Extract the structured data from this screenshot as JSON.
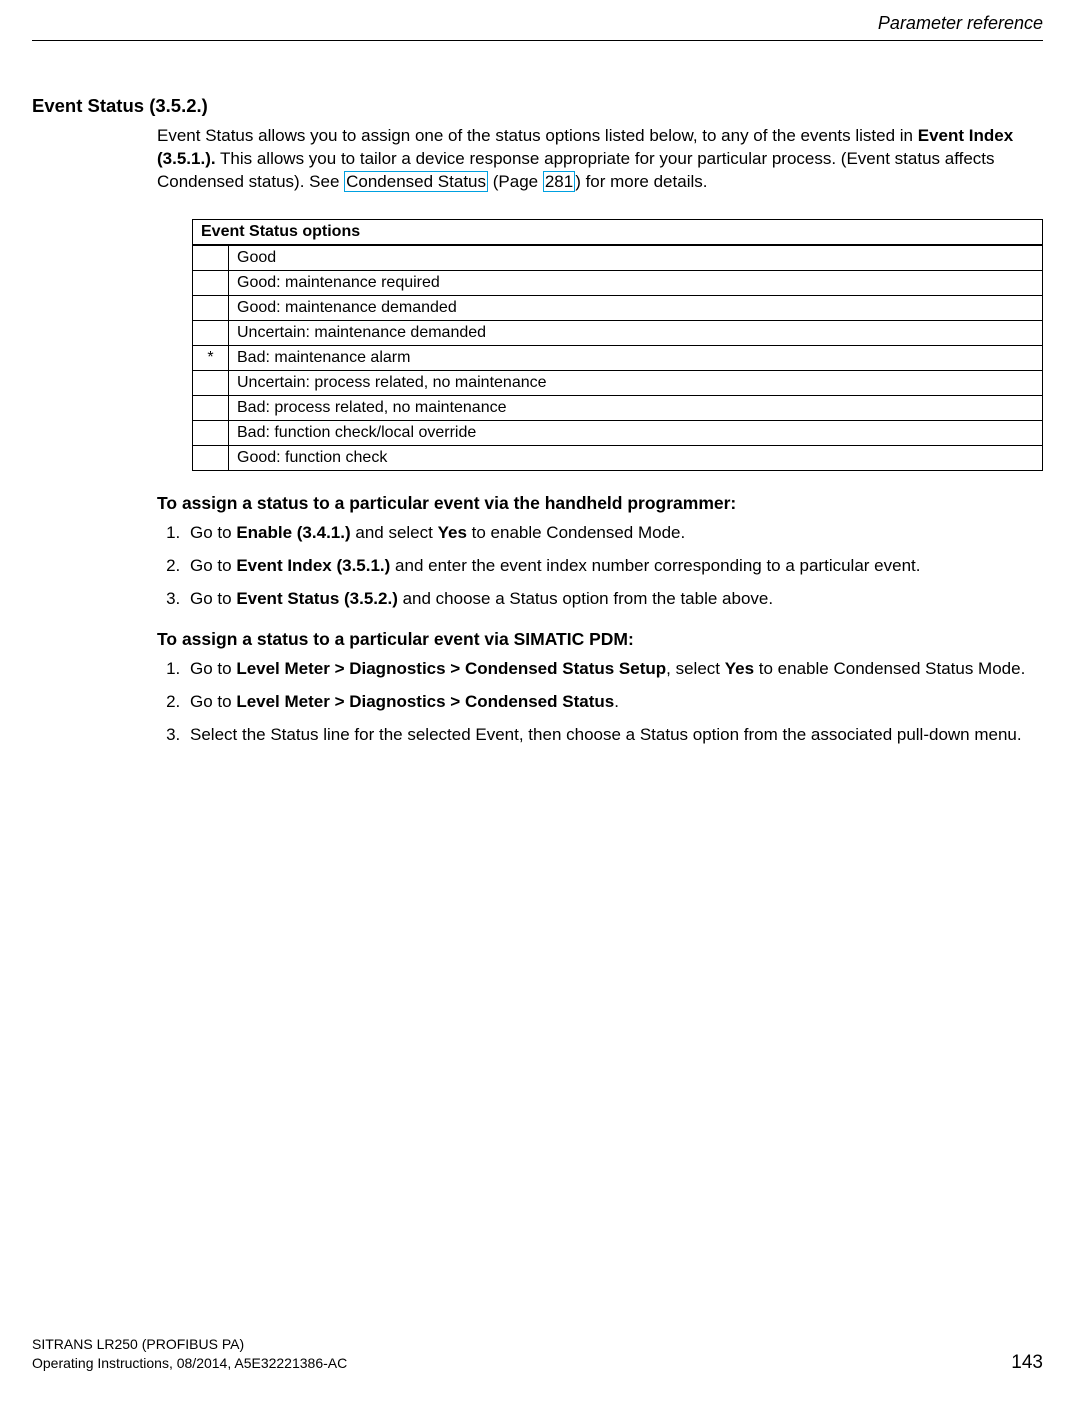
{
  "header": {
    "title": "Parameter reference"
  },
  "section": {
    "heading": "Event Status (3.5.2.)",
    "intro_pre": "Event Status allows you to assign one of the status options listed below, to any of the events listed in ",
    "intro_bold": "Event Index (3.5.1.).",
    "intro_mid": " This allows you to tailor a device response appropriate for your particular process. (Event status affects Condensed status). See ",
    "link_condensed": "Condensed Status",
    "intro_pg_pre": " (Page ",
    "link_page": "281",
    "intro_post": ") for more details."
  },
  "table": {
    "header": "Event Status options",
    "rows": [
      {
        "mark": "",
        "label": "Good"
      },
      {
        "mark": "",
        "label": "Good: maintenance required"
      },
      {
        "mark": "",
        "label": "Good: maintenance demanded"
      },
      {
        "mark": "",
        "label": "Uncertain: maintenance demanded"
      },
      {
        "mark": "*",
        "label": "Bad: maintenance alarm"
      },
      {
        "mark": "",
        "label": "Uncertain: process related, no maintenance"
      },
      {
        "mark": "",
        "label": "Bad: process related, no maintenance"
      },
      {
        "mark": "",
        "label": "Bad: function check/local override"
      },
      {
        "mark": "",
        "label": "Good: function check"
      }
    ]
  },
  "handheld": {
    "heading": "To assign a status to a particular event via the handheld programmer:",
    "steps": [
      {
        "pre": "Go to ",
        "b1": "Enable (3.4.1.)",
        "mid": " and select ",
        "b2": "Yes",
        "post": " to enable Condensed Mode."
      },
      {
        "pre": "Go to ",
        "b1": "Event Index (3.5.1.)",
        "mid": "",
        "b2": "",
        "post": " and enter the event index number corresponding to a particular event."
      },
      {
        "pre": "Go to ",
        "b1": "Event Status (3.5.2.)",
        "mid": "",
        "b2": "",
        "post": " and choose a Status option from the table above."
      }
    ]
  },
  "pdm": {
    "heading": "To assign a status to a particular event via SIMATIC PDM:",
    "steps": [
      {
        "pre": "Go to ",
        "b1": "Level Meter > Diagnostics > Condensed Status Setup",
        "mid": ", select ",
        "b2": "Yes",
        "post": " to enable Condensed Status Mode."
      },
      {
        "pre": "Go to ",
        "b1": "Level Meter > Diagnostics > Condensed Status",
        "mid": "",
        "b2": "",
        "post": "."
      },
      {
        "pre": "",
        "b1": "",
        "mid": "",
        "b2": "",
        "post": "Select the Status line for the selected Event, then choose a Status option from the associated pull-down menu."
      }
    ]
  },
  "footer": {
    "line1": "SITRANS LR250 (PROFIBUS PA)",
    "line2": "Operating Instructions, 08/2014, A5E32221386-AC",
    "page": "143"
  }
}
